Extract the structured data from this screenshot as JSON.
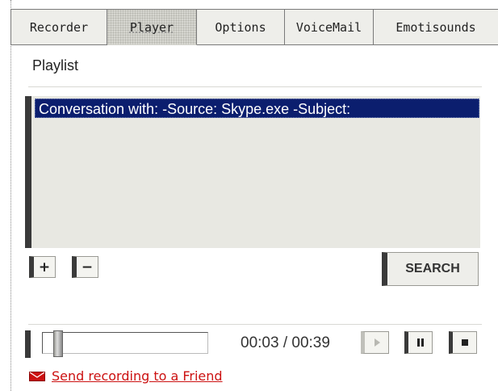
{
  "tabs": [
    {
      "label": "Recorder"
    },
    {
      "label": "Player"
    },
    {
      "label": "Options"
    },
    {
      "label": "VoiceMail"
    },
    {
      "label": "Emotisounds"
    }
  ],
  "playlist": {
    "label": "Playlist",
    "items": [
      "Conversation with:  -Source: Skype.exe -Subject:"
    ],
    "selected_index": 0
  },
  "buttons": {
    "add": "+",
    "remove": "−",
    "search": "SEARCH"
  },
  "player": {
    "time": "00:03 / 00:39",
    "position_fraction": 0.077
  },
  "send_link": "Send recording to a Friend",
  "colors": {
    "selection": "#0b1e6e",
    "link": "#cc1111",
    "accent_dark": "#3a3a3a"
  }
}
